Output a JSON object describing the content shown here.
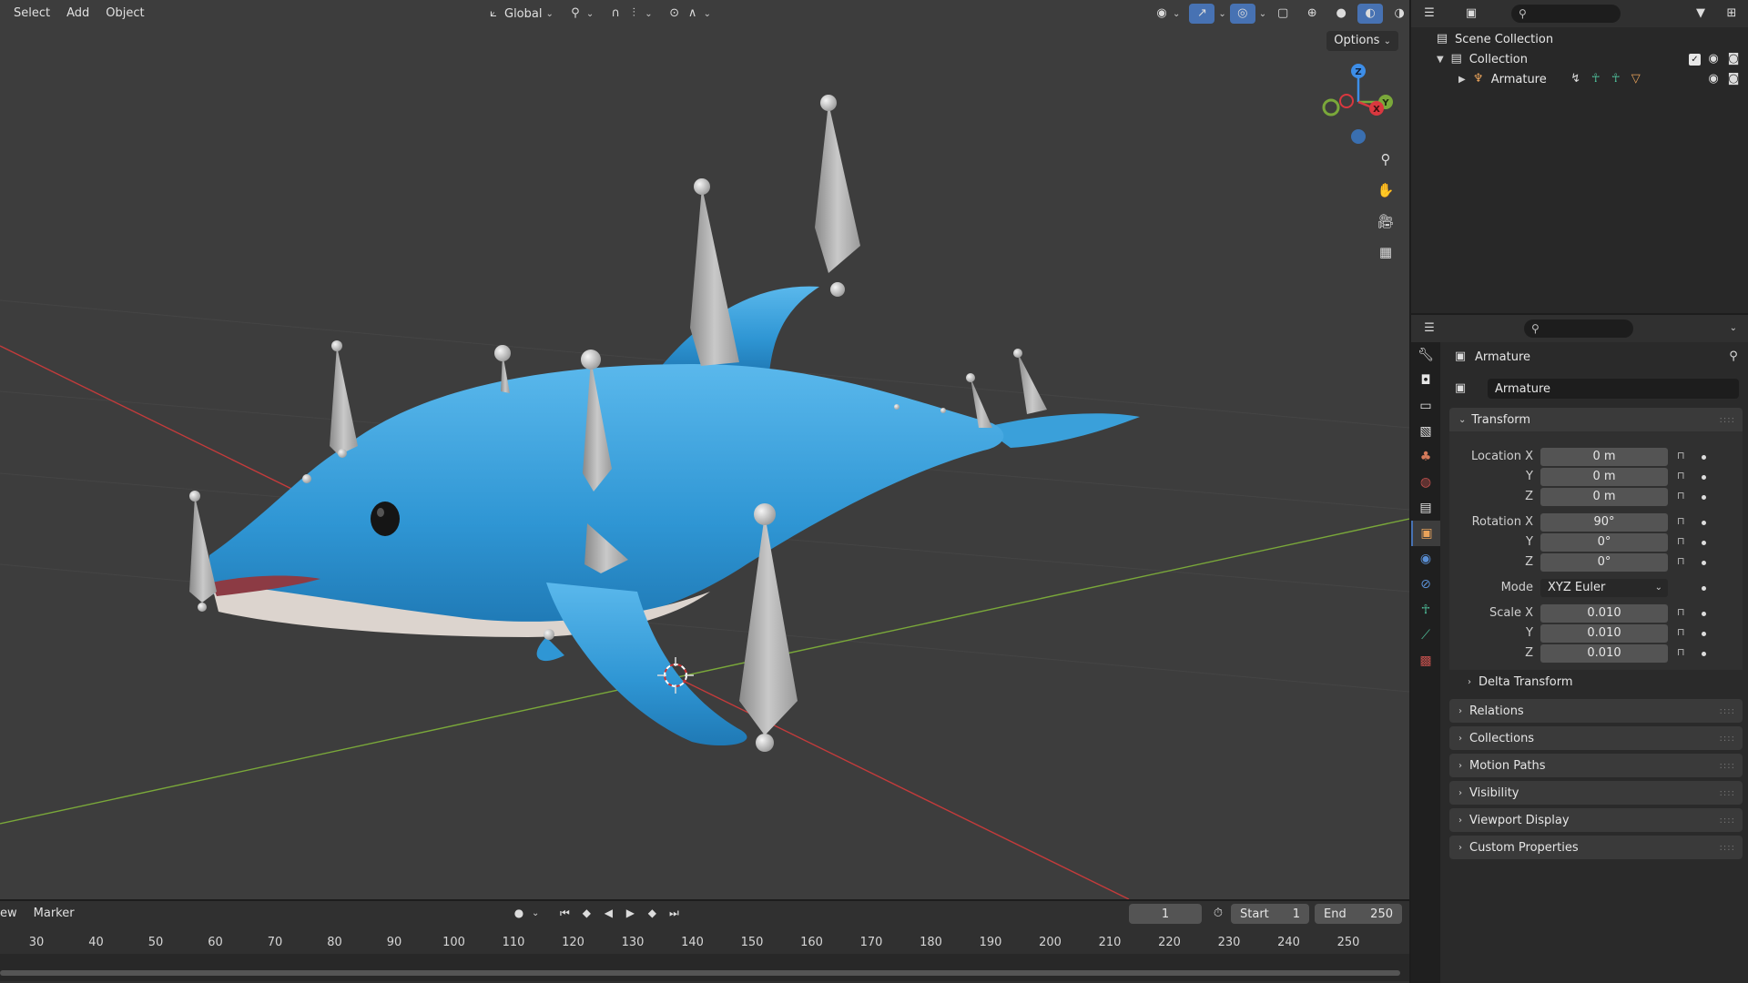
{
  "viewport": {
    "menus": [
      "Select",
      "Add",
      "Object"
    ],
    "orientation_label": "Global",
    "options_label": "Options",
    "gizmo_axes": {
      "x": "X",
      "y": "Y",
      "z": "Z"
    }
  },
  "timeline": {
    "menus": [
      "ew",
      "Marker"
    ],
    "current_frame": "1",
    "start_label": "Start",
    "start_value": "1",
    "end_label": "End",
    "end_value": "250",
    "ruler_ticks": [
      "30",
      "40",
      "50",
      "60",
      "70",
      "80",
      "90",
      "100",
      "110",
      "120",
      "130",
      "140",
      "150",
      "160",
      "170",
      "180",
      "190",
      "200",
      "210",
      "220",
      "230",
      "240",
      "250"
    ]
  },
  "outliner": {
    "scene_collection": "Scene Collection",
    "collection": "Collection",
    "armature": "Armature"
  },
  "properties": {
    "object_title": "Armature",
    "object_name": "Armature",
    "transform_title": "Transform",
    "location_label": "Location X",
    "location": [
      "0 m",
      "0 m",
      "0 m"
    ],
    "rotation_label": "Rotation X",
    "rotation": [
      "90°",
      "0°",
      "0°"
    ],
    "mode_label": "Mode",
    "mode_value": "XYZ Euler",
    "scale_label": "Scale X",
    "scale": [
      "0.010",
      "0.010",
      "0.010"
    ],
    "axis_y": "Y",
    "axis_z": "Z",
    "delta_transform": "Delta Transform",
    "panels": [
      "Relations",
      "Collections",
      "Motion Paths",
      "Visibility",
      "Viewport Display",
      "Custom Properties"
    ]
  },
  "colors": {
    "accent": "#4772b3",
    "viewport_bg": "#3d3d3d",
    "dolphin": "#3aa0da",
    "axis_x": "#c43b3b",
    "axis_y": "#7aa83a"
  }
}
